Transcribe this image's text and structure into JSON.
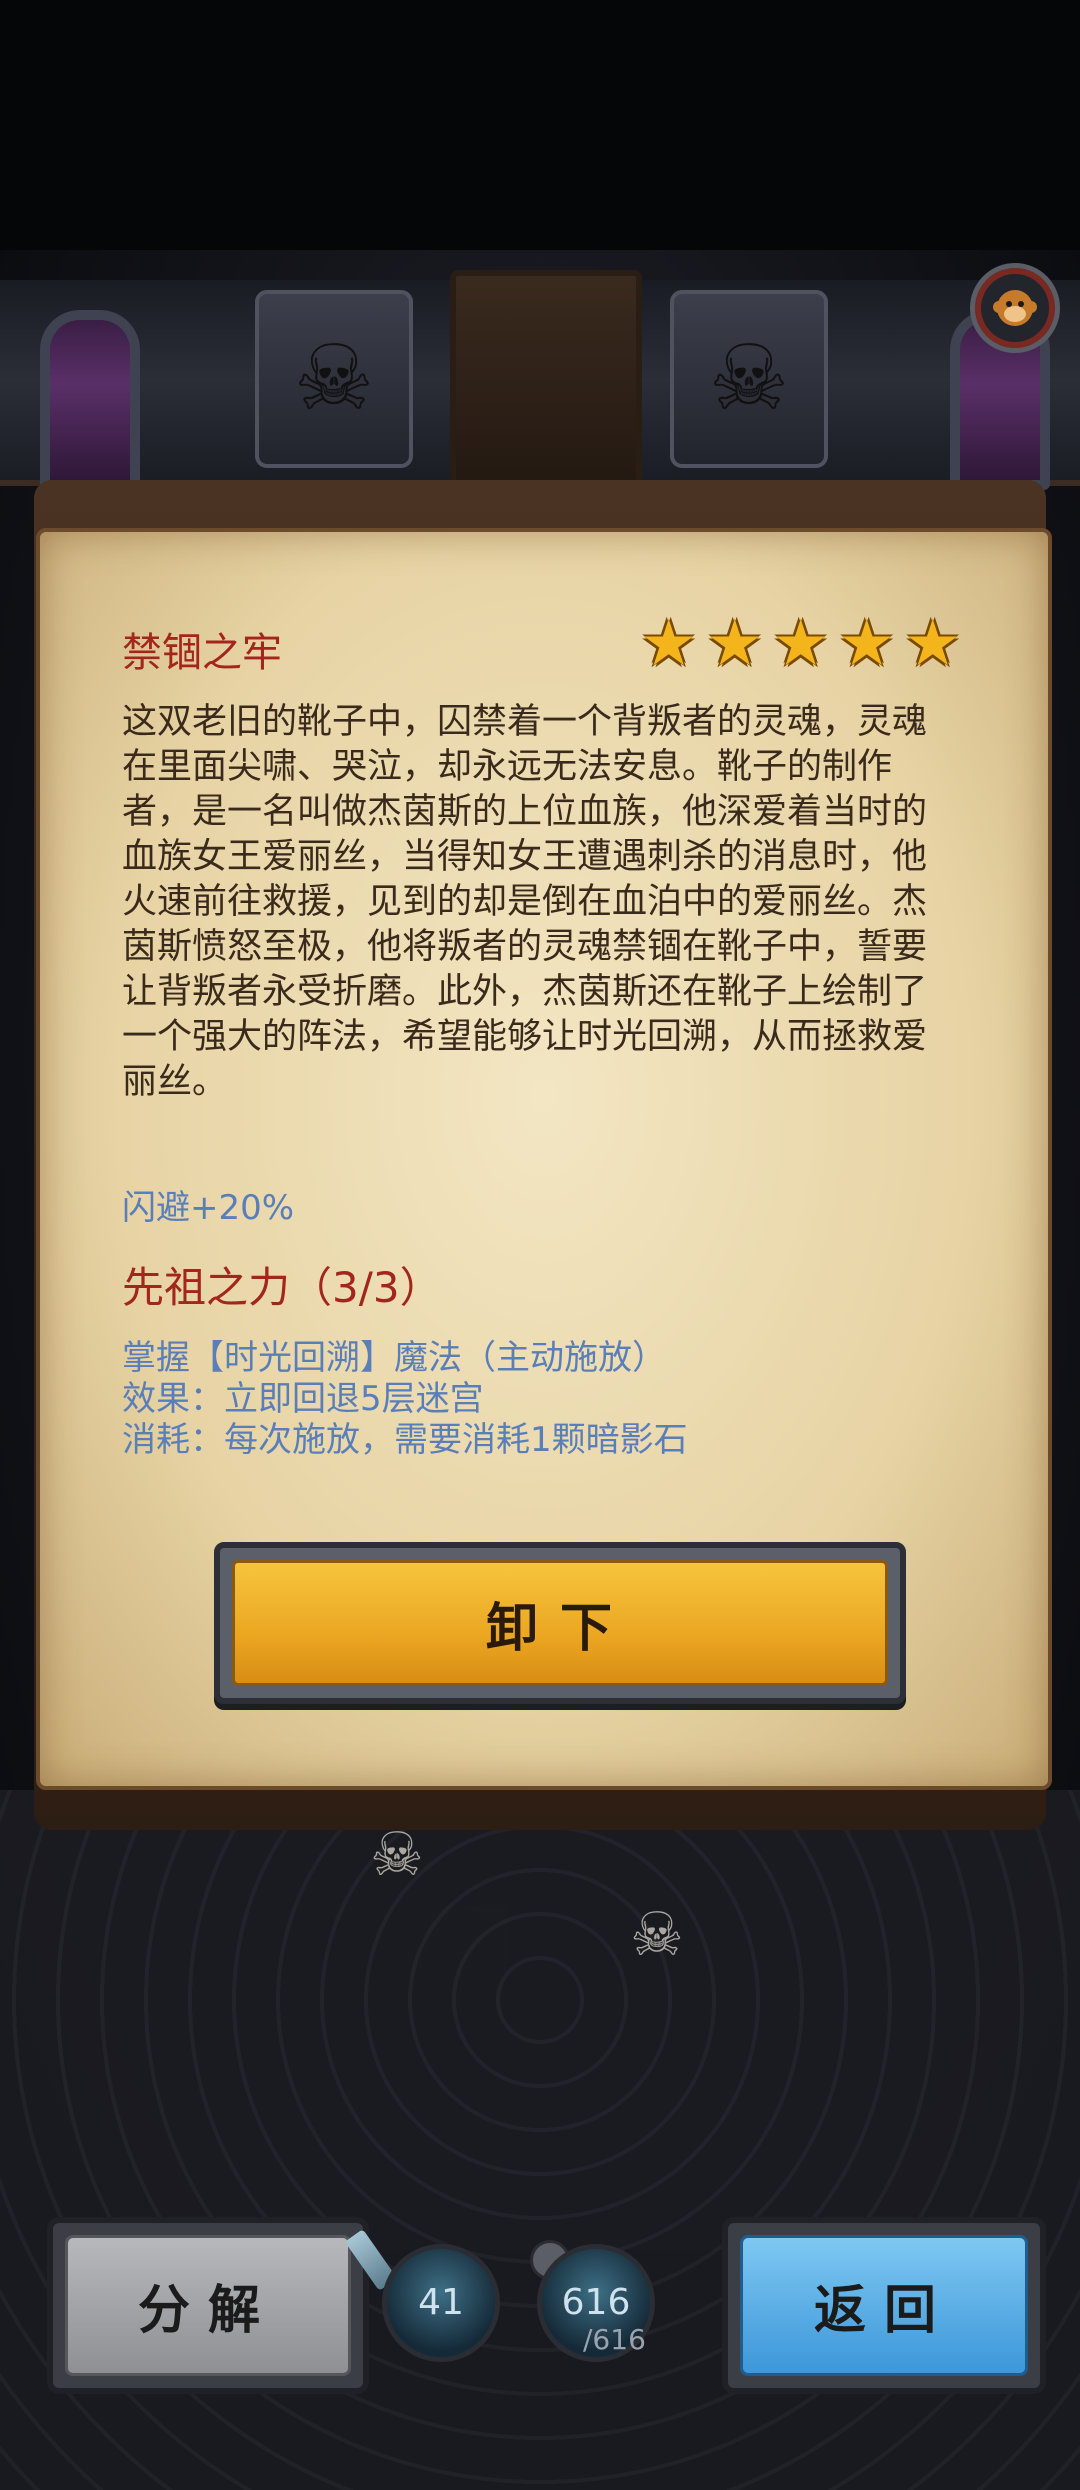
{
  "item": {
    "name": "禁锢之牢",
    "stars": 5,
    "star_glyph": "★",
    "description": "这双老旧的靴子中，囚禁着一个背叛者的灵魂，灵魂在里面尖啸、哭泣，却永远无法安息。靴子的制作者，是一名叫做杰茵斯的上位血族，他深爱着当时的血族女王爱丽丝，当得知女王遭遇刺杀的消息时，他火速前往救援，见到的却是倒在血泊中的爱丽丝。杰茵斯愤怒至极，他将叛者的灵魂禁锢在靴子中，誓要让背叛者永受折磨。此外，杰茵斯还在靴子上绘制了一个强大的阵法，希望能够让时光回溯，从而拯救爱丽丝。",
    "stat": "闪避+20%",
    "set_power": {
      "title": "先祖之力（3/3）",
      "lines": [
        "掌握【时光回溯】魔法（主动施放）",
        "效果：立即回退5层迷宫",
        "消耗：每次施放，需要消耗1颗暗影石"
      ]
    }
  },
  "buttons": {
    "unequip": "卸下",
    "decompose": "分解",
    "back": "返回"
  },
  "resources": {
    "wand_count": "41",
    "potion_count": "616",
    "potion_max": "/616"
  },
  "colors": {
    "title_red": "#a3261c",
    "stat_blue": "#5a7fb8",
    "star_gold": "#f4b41c"
  },
  "icons": {
    "avatar": "monkey-face-icon",
    "floor_skull": "☠"
  }
}
